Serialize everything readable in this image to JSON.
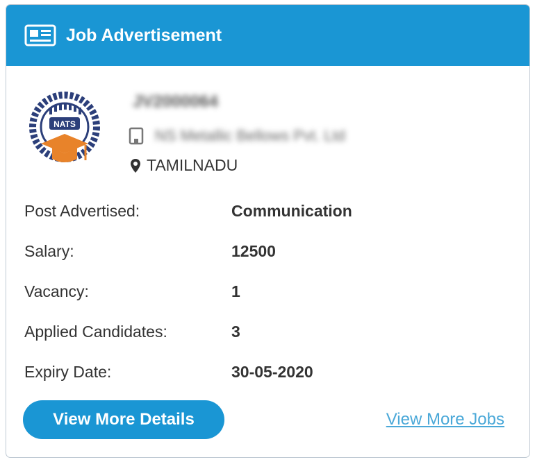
{
  "header": {
    "title": "Job Advertisement",
    "icon": "newspaper-icon",
    "color": "#1a96d4"
  },
  "company": {
    "logo_text": "NATS",
    "reference_id": "JV2000064",
    "employer_name": "NS Metallic Bellows Pvt. Ltd",
    "location": "TAMILNADU"
  },
  "details": [
    {
      "label": "Post Advertised:",
      "value": "Communication"
    },
    {
      "label": "Salary:",
      "value": "12500"
    },
    {
      "label": "Vacancy:",
      "value": "1"
    },
    {
      "label": "Applied Candidates:",
      "value": "3"
    },
    {
      "label": "Expiry Date:",
      "value": "30-05-2020"
    }
  ],
  "actions": {
    "view_details": "View More Details",
    "view_jobs": "View More Jobs"
  }
}
